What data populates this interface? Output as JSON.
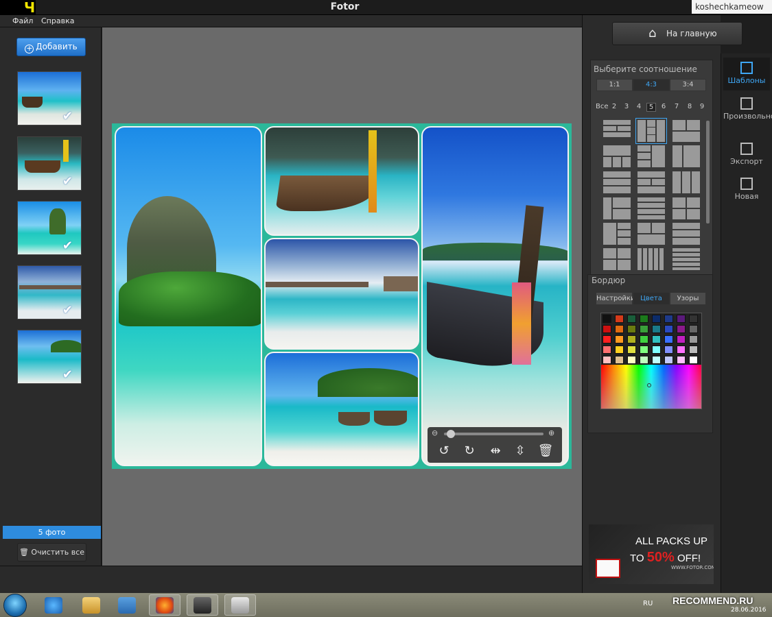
{
  "window": {
    "title": "Fotor",
    "badge": "Ч",
    "watermark": "koshechkameow"
  },
  "menu": {
    "file": "Файл",
    "help": "Справка"
  },
  "left_panel": {
    "add_label": "Добавить",
    "photo_count": "5 фото",
    "clear_label": "Очистить все"
  },
  "header": {
    "home_label": "На главную"
  },
  "right_nav": {
    "templates": "Шаблоны",
    "freeform": "Произвольно",
    "export": "Экспорт",
    "new": "Новая"
  },
  "settings": {
    "ratio_title": "Выберите соотношение",
    "ratios": [
      "1:1",
      "4:3",
      "3:4"
    ],
    "ratio_selected": "4:3",
    "count_tabs": [
      "Все",
      "2",
      "3",
      "4",
      "5",
      "6",
      "7",
      "8",
      "9"
    ],
    "count_selected": "5",
    "border_title": "Бордюр",
    "border_tabs": [
      "Настройки",
      "Цвета",
      "Узоры"
    ],
    "border_tab_selected": "Цвета",
    "collage_bg_color": "#2bb89a"
  },
  "ad": {
    "line1": "ALL PACKS UP",
    "to": "TO",
    "discount": "50%",
    "off": "OFF!",
    "site": "WWW.FOTOR.COM"
  },
  "taskbar": {
    "lang": "RU",
    "date": "28.06.2016",
    "recommend": "RECOMMEND.RU"
  },
  "icons": {
    "add": "plus-circle-icon",
    "home": "home-icon",
    "trash": "trash-icon",
    "check": "check-icon",
    "rotate_left": "rotate-left-icon",
    "rotate_right": "rotate-right-icon",
    "flip_h": "flip-horizontal-icon",
    "flip_v": "flip-vertical-icon",
    "zoom_out": "zoom-out-icon",
    "zoom_in": "zoom-in-icon"
  },
  "palette_colors": [
    "#111111",
    "#d43a1a",
    "#1a5e3a",
    "#1c7a1c",
    "#0c2c6a",
    "#1e3a8a",
    "#5a1a7a",
    "#333333",
    "#cc1010",
    "#e06a10",
    "#6a7a10",
    "#3aa03a",
    "#1a7a8a",
    "#2a4ac0",
    "#8a1a8a",
    "#666666",
    "#ff2020",
    "#ff9a20",
    "#b0b020",
    "#40d040",
    "#30c0c0",
    "#3a70ff",
    "#c020c0",
    "#999999",
    "#ff7070",
    "#ffd020",
    "#e0e040",
    "#80ff80",
    "#80ffff",
    "#8090ff",
    "#ff70ff",
    "#bbbbbb",
    "#ffc0c0",
    "#e0c090",
    "#ffffc0",
    "#c0ffc0",
    "#c0ffff",
    "#c0c8ff",
    "#ffc0ff",
    "#ffffff"
  ]
}
